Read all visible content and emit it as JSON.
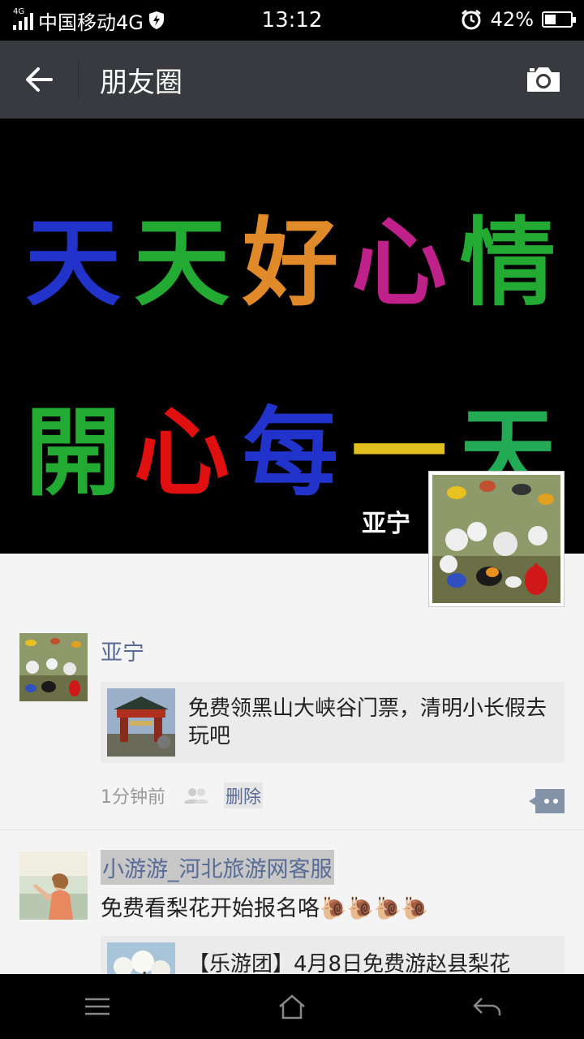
{
  "status_bar": {
    "network_tag": "4G",
    "carrier": "中国移动4G",
    "time": "13:12",
    "battery_percent_text": "42%",
    "battery_level": 0.42
  },
  "toolbar": {
    "back_icon": "arrow-left-icon",
    "title": "朋友圈",
    "camera_icon": "camera-icon"
  },
  "cover": {
    "line1": [
      {
        "char": "天",
        "color": "#2233cc"
      },
      {
        "char": "天",
        "color": "#22aa33"
      },
      {
        "char": "好",
        "color": "#e08a2a"
      },
      {
        "char": "心",
        "color": "#c0208a"
      },
      {
        "char": "情",
        "color": "#22aa33"
      }
    ],
    "line2": [
      {
        "char": "開",
        "color": "#22aa33"
      },
      {
        "char": "心",
        "color": "#e01010"
      },
      {
        "char": "每",
        "color": "#2233cc"
      },
      {
        "char": "一",
        "color": "#e0c020"
      },
      {
        "char": "天",
        "color": "#22aa55"
      }
    ],
    "user_name": "亚宁"
  },
  "posts": [
    {
      "nickname": "亚宁",
      "share_text": "免费领黑山大峡谷门票，清明小长假去玩吧",
      "time": "1分钟前",
      "delete_label": "删除"
    },
    {
      "nickname": "小游游_河北旅游网客服",
      "text": "免费看梨花开始报名咯",
      "emoji": "🐌🐌🐌🐌",
      "share_text": "【乐游团】4月8日免费游赵县梨花"
    }
  ],
  "nav": {
    "menu_icon": "menu-icon",
    "home_icon": "home-icon",
    "back_icon": "back-icon"
  }
}
